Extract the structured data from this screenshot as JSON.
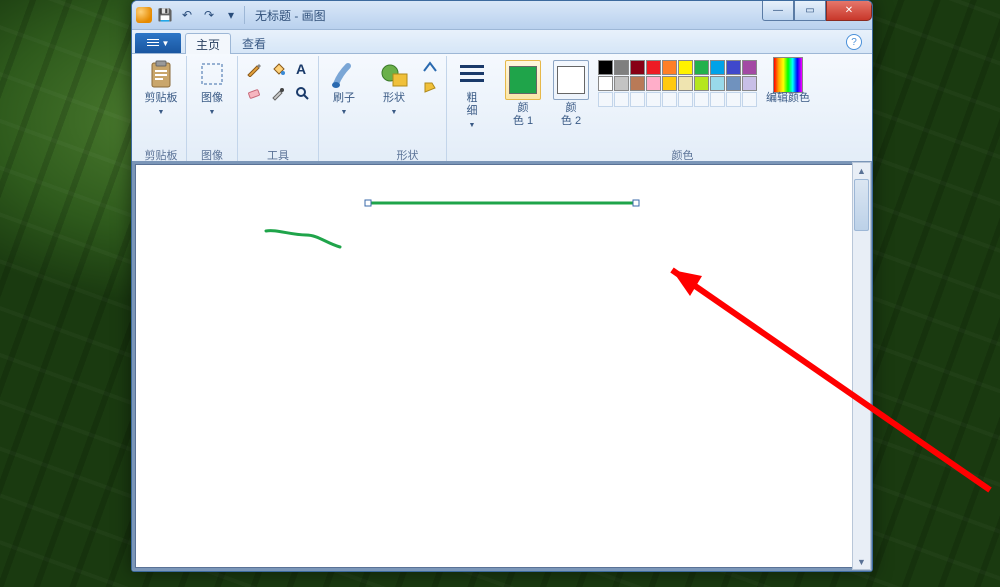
{
  "window": {
    "title": "无标题 - 画图",
    "qat": {
      "save": "💾",
      "undo": "↶",
      "redo": "↷",
      "chevron": "▾"
    },
    "buttons": {
      "min": "—",
      "max": "▭",
      "close": "✕"
    }
  },
  "tabs": {
    "home": "主页",
    "view": "查看"
  },
  "ribbon": {
    "clipboard": {
      "label": "剪贴板",
      "btn": "剪贴板"
    },
    "image": {
      "label": "图像",
      "btn": "图像"
    },
    "tools": {
      "label": "工具"
    },
    "brush": {
      "btn": "刷子"
    },
    "shapes": {
      "label": "形状",
      "btn": "形状"
    },
    "size": {
      "btn": "粗\n细"
    },
    "color1": {
      "btn": "颜\n色 1"
    },
    "color2": {
      "btn": "颜\n色 2"
    },
    "editcolors": {
      "btn": "编辑颜色"
    },
    "colors": {
      "label": "颜色"
    }
  },
  "colors": {
    "primary": "#1fa44a",
    "secondary": "#ffffff",
    "palette_row1": [
      "#000000",
      "#7f7f7f",
      "#880015",
      "#ed1c24",
      "#ff7f27",
      "#fff200",
      "#22b14c",
      "#00a2e8",
      "#3f48cc",
      "#a349a4"
    ],
    "palette_row2": [
      "#ffffff",
      "#c3c3c3",
      "#b97a57",
      "#ffaec9",
      "#ffc90e",
      "#efe4b0",
      "#b5e61d",
      "#99d9ea",
      "#7092be",
      "#c8bfe7"
    ]
  },
  "help": "?"
}
